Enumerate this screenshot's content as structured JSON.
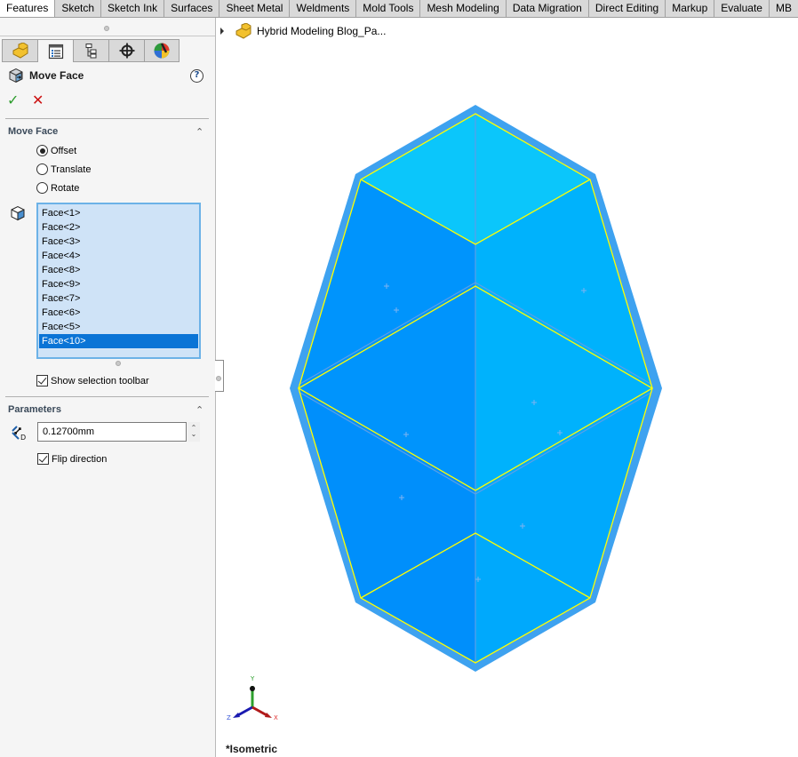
{
  "command_tabs": [
    {
      "label": "Features",
      "active": true
    },
    {
      "label": "Sketch"
    },
    {
      "label": "Sketch Ink"
    },
    {
      "label": "Surfaces"
    },
    {
      "label": "Sheet Metal"
    },
    {
      "label": "Weldments"
    },
    {
      "label": "Mold Tools"
    },
    {
      "label": "Mesh Modeling"
    },
    {
      "label": "Data Migration"
    },
    {
      "label": "Direct Editing"
    },
    {
      "label": "Markup"
    },
    {
      "label": "Evaluate"
    },
    {
      "label": "MB"
    }
  ],
  "panel_tabs": [
    {
      "icon": "feature-manager-icon"
    },
    {
      "icon": "property-manager-icon",
      "active": true
    },
    {
      "icon": "configuration-manager-icon"
    },
    {
      "icon": "dimxpert-manager-icon"
    },
    {
      "icon": "display-manager-icon"
    }
  ],
  "property_manager": {
    "title": "Move Face",
    "help_label": "?",
    "ok_label": "✓",
    "cancel_label": "✕"
  },
  "move_face_section": {
    "header": "Move Face",
    "collapse_label": "⌃",
    "options": [
      {
        "label": "Offset",
        "selected": true
      },
      {
        "label": "Translate",
        "selected": false
      },
      {
        "label": "Rotate",
        "selected": false
      }
    ],
    "faces": [
      "Face<1>",
      "Face<2>",
      "Face<3>",
      "Face<4>",
      "Face<8>",
      "Face<9>",
      "Face<7>",
      "Face<6>",
      "Face<5>",
      "Face<10>"
    ],
    "selected_face": "Face<10>",
    "show_selection_toolbar": {
      "label": "Show selection toolbar",
      "checked": true
    }
  },
  "parameters_section": {
    "header": "Parameters",
    "collapse_label": "⌃",
    "distance_value": "0.12700mm",
    "spin_up": "⌃",
    "spin_down": "⌄",
    "flip_direction": {
      "label": "Flip direction",
      "checked": true
    }
  },
  "viewport": {
    "tree_root": "Hybrid Modeling Blog_Pa...",
    "view_orientation": "*Isometric",
    "triad": {
      "x": "X",
      "y": "Y",
      "z": "Z"
    }
  },
  "colors": {
    "face_top": "#0bc6fb",
    "face_left": "#0094fc",
    "face_right": "#00b2fc",
    "face_left_lower": "#008ffb",
    "face_right_lower": "#00a9fc",
    "outline": "#3ea2f0",
    "selection_edge": "#ffff00",
    "list_highlight": "#0a74d6"
  }
}
